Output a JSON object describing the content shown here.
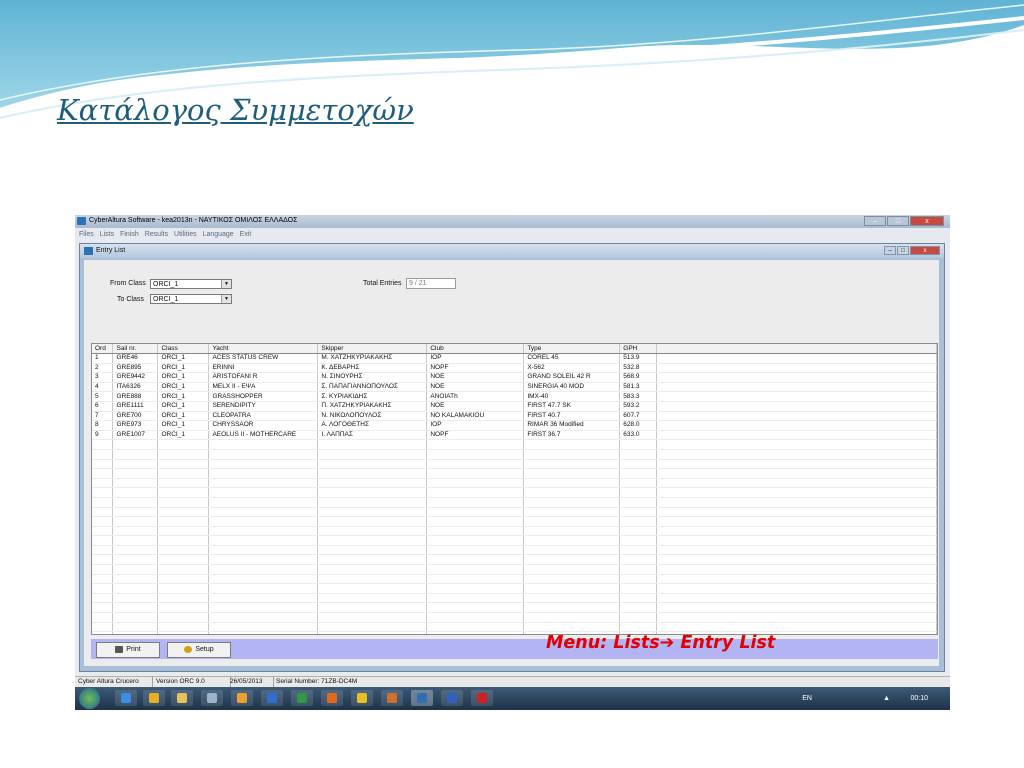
{
  "slide": {
    "title": "Κατάλογος Συμμετοχών",
    "caption_prefix": "Menu: Lists",
    "caption_arrow": "➔",
    "caption_suffix": "Entry List"
  },
  "app": {
    "title": "CyberAltura Software  - kea2013n - ΝΑΥΤΙΚΟΣ ΟΜΙΛΟΣ ΕΛΛΑΔΟΣ",
    "menu": [
      "Files",
      "Lists",
      "Finish",
      "Results",
      "Utilities",
      "Language",
      "Exit"
    ]
  },
  "window": {
    "title": "Entry List",
    "from_class_label": "From Class",
    "from_class_value": "ORCI_1",
    "to_class_label": "To Class",
    "to_class_value": "ORCI_1",
    "total_entries_label": "Total Entries",
    "total_entries_value": "9 / 21",
    "print_label": "Print",
    "setup_label": "Setup"
  },
  "table": {
    "columns": [
      "Ord",
      "Sail nr.",
      "Class",
      "Yacht",
      "Skipper",
      "Club",
      "Type",
      "GPH"
    ],
    "rows": [
      [
        "1",
        "GRE46",
        "ORCI_1",
        "ACES STATUS CREW",
        "Μ. ΧΑΤΖΗΚΥΡΙΑΚΑΚΗΣ",
        "IOP",
        "COREL 45",
        "513.9"
      ],
      [
        "2",
        "GRE895",
        "ORCI_1",
        "ERINNI",
        "Κ. ΔΕΒΑΡΗΣ",
        "NOPF",
        "X-562",
        "532.8"
      ],
      [
        "3",
        "GRE9442",
        "ORCI_1",
        "ARISTOFANI R",
        "Ν. ΣΙΝΟΥΡΗΣ",
        "NOE",
        "GRAND SOLEIL 42 R",
        "568.9"
      ],
      [
        "4",
        "ITA6326",
        "ORCI_1",
        "MELX II - ΕΨΑ",
        "Σ. ΠΑΠΑΓΙΑΝΝΟΠΟΥΛΟΣ",
        "NOE",
        "SINERGIA 40 MOD",
        "581.3"
      ],
      [
        "5",
        "GRE888",
        "ORCI_1",
        "GRASSHOPPER",
        "Σ. ΚΥΡΙΑΚΙΔΗΣ",
        "ANOIATh",
        "IMX-40",
        "583.3"
      ],
      [
        "6",
        "GRE1111",
        "ORCI_1",
        "SERENDIPITY",
        "Π. ΧΑΤΖΗΚΥΡΙΑΚΑΚΗΣ",
        "NOE",
        "FIRST 47.7 SK",
        "593.2"
      ],
      [
        "7",
        "GRE700",
        "ORCI_1",
        "CLEOPATRA",
        "Ν. ΝΙΚΟΛΟΠΟΥΛΟΣ",
        "NO KALAMAKIOU",
        "FIRST 40.7",
        "607.7"
      ],
      [
        "8",
        "GRE973",
        "ORCI_1",
        "CHRYSSAOR",
        "Α. ΛΟΓΟΘΕΤΗΣ",
        "IOP",
        "RIMAR 36 Modified",
        "628.0"
      ],
      [
        "9",
        "GRE1007",
        "ORCI_1",
        "AEOLUS II - MOTHERCARE",
        "Ι. ΛΑΠΠΑΣ",
        "NOPF",
        "FIRST 36.7",
        "633.0"
      ]
    ]
  },
  "status": {
    "app_name": "Cyber Altura Crucero",
    "version": "Version ORC 9.0",
    "date": "26/05/2013",
    "serial": "Serial Number: 71ZB-DC4M"
  },
  "taskbar": {
    "lang": "EN",
    "clock": "00:10"
  },
  "colors": {
    "title_blue": "#1f5d7a",
    "caption_red": "#e30000",
    "bottom_bar": "#b3b4f3"
  }
}
